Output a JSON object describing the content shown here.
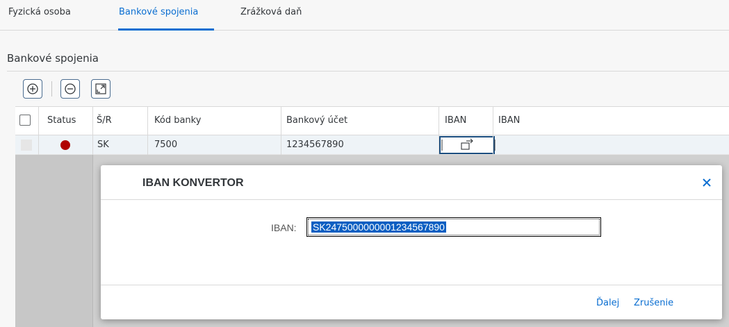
{
  "tabs": [
    {
      "label": "Fyzická osoba",
      "active": false
    },
    {
      "label": "Bankové spojenia",
      "active": true
    },
    {
      "label": "Zrážková daň",
      "active": false
    }
  ],
  "section": {
    "title": "Bankové spojenia"
  },
  "toolbar": {
    "buttons": [
      {
        "icon": "add-circle-icon"
      },
      {
        "icon": "remove-circle-icon"
      },
      {
        "icon": "expand-icon"
      }
    ]
  },
  "table": {
    "columns": [
      "Status",
      "Š/R",
      "Kód banky",
      "Bankový účet",
      "IBAN",
      "IBAN"
    ],
    "rows": [
      {
        "status_color": "#b00000",
        "country": "SK",
        "bank_code": "7500",
        "account": "1234567890",
        "iban_button_icon": "open-external-icon",
        "iban": ""
      }
    ]
  },
  "dialog": {
    "title": "IBAN KONVERTOR",
    "close_icon": "close-icon",
    "field_label": "IBAN:",
    "field_value": "SK2475000000001234567890",
    "next_label": "Ďalej",
    "cancel_label": "Zrušenie"
  },
  "colors": {
    "accent": "#0a6ed1",
    "selection": "#0b5fc2",
    "status_red": "#b00000"
  }
}
